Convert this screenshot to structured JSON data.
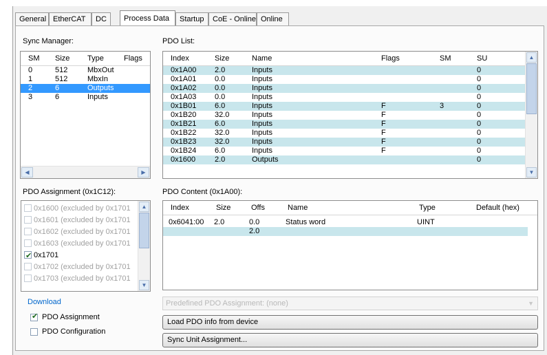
{
  "tabs": [
    {
      "label": "General"
    },
    {
      "label": "EtherCAT"
    },
    {
      "label": "DC"
    },
    {
      "label": "Process Data"
    },
    {
      "label": "Startup"
    },
    {
      "label": "CoE - Online"
    },
    {
      "label": "Online"
    }
  ],
  "sync_manager": {
    "label": "Sync Manager:",
    "columns": [
      "SM",
      "Size",
      "Type",
      "Flags"
    ],
    "rows": [
      {
        "sm": "0",
        "size": "512",
        "type": "MbxOut",
        "flags": ""
      },
      {
        "sm": "1",
        "size": "512",
        "type": "MbxIn",
        "flags": ""
      },
      {
        "sm": "2",
        "size": "6",
        "type": "Outputs",
        "flags": ""
      },
      {
        "sm": "3",
        "size": "6",
        "type": "Inputs",
        "flags": ""
      }
    ]
  },
  "pdo_list": {
    "label": "PDO List:",
    "columns": [
      "Index",
      "Size",
      "Name",
      "Flags",
      "SM",
      "SU"
    ],
    "rows": [
      {
        "index": "0x1A00",
        "size": "2.0",
        "name": "Inputs",
        "flags": "",
        "sm": "",
        "su": "0"
      },
      {
        "index": "0x1A01",
        "size": "0.0",
        "name": "Inputs",
        "flags": "",
        "sm": "",
        "su": "0"
      },
      {
        "index": "0x1A02",
        "size": "0.0",
        "name": "Inputs",
        "flags": "",
        "sm": "",
        "su": "0"
      },
      {
        "index": "0x1A03",
        "size": "0.0",
        "name": "Inputs",
        "flags": "",
        "sm": "",
        "su": "0"
      },
      {
        "index": "0x1B01",
        "size": "6.0",
        "name": "Inputs",
        "flags": "F",
        "sm": "3",
        "su": "0"
      },
      {
        "index": "0x1B20",
        "size": "32.0",
        "name": "Inputs",
        "flags": "F",
        "sm": "",
        "su": "0"
      },
      {
        "index": "0x1B21",
        "size": "6.0",
        "name": "Inputs",
        "flags": "F",
        "sm": "",
        "su": "0"
      },
      {
        "index": "0x1B22",
        "size": "32.0",
        "name": "Inputs",
        "flags": "F",
        "sm": "",
        "su": "0"
      },
      {
        "index": "0x1B23",
        "size": "32.0",
        "name": "Inputs",
        "flags": "F",
        "sm": "",
        "su": "0"
      },
      {
        "index": "0x1B24",
        "size": "6.0",
        "name": "Inputs",
        "flags": "F",
        "sm": "",
        "su": "0"
      },
      {
        "index": "0x1600",
        "size": "2.0",
        "name": "Outputs",
        "flags": "",
        "sm": "",
        "su": "0"
      }
    ]
  },
  "pdo_assignment": {
    "label": "PDO Assignment (0x1C12):",
    "items": [
      {
        "label": "0x1600 (excluded by 0x1701",
        "checked": false,
        "enabled": false
      },
      {
        "label": "0x1601 (excluded by 0x1701",
        "checked": false,
        "enabled": false
      },
      {
        "label": "0x1602 (excluded by 0x1701",
        "checked": false,
        "enabled": false
      },
      {
        "label": "0x1603 (excluded by 0x1701",
        "checked": false,
        "enabled": false
      },
      {
        "label": "0x1701",
        "checked": true,
        "enabled": true
      },
      {
        "label": "0x1702 (excluded by 0x1701",
        "checked": false,
        "enabled": false
      },
      {
        "label": "0x1703 (excluded by 0x1701",
        "checked": false,
        "enabled": false
      }
    ]
  },
  "pdo_content": {
    "label": "PDO Content (0x1A00):",
    "columns": [
      "Index",
      "Size",
      "Offs",
      "Name",
      "Type",
      "Default (hex)"
    ],
    "rows": [
      {
        "index": "0x6041:00",
        "size": "2.0",
        "offs": "0.0",
        "name": "Status word",
        "type": "UINT",
        "default": ""
      },
      {
        "index": "",
        "size": "",
        "offs": "2.0",
        "name": "",
        "type": "",
        "default": ""
      }
    ]
  },
  "download": {
    "label": "Download",
    "pdo_assignment": {
      "label": "PDO Assignment",
      "checked": true
    },
    "pdo_configuration": {
      "label": "PDO Configuration",
      "checked": false
    }
  },
  "predefined": {
    "label": "Predefined PDO Assignment: (none)"
  },
  "buttons": {
    "load_pdo": "Load PDO info from device",
    "sync_unit": "Sync Unit Assignment..."
  },
  "colors": {
    "selection": "#3399ff",
    "alt_row": "#c8e6ec",
    "link_blue": "#0066cc"
  }
}
